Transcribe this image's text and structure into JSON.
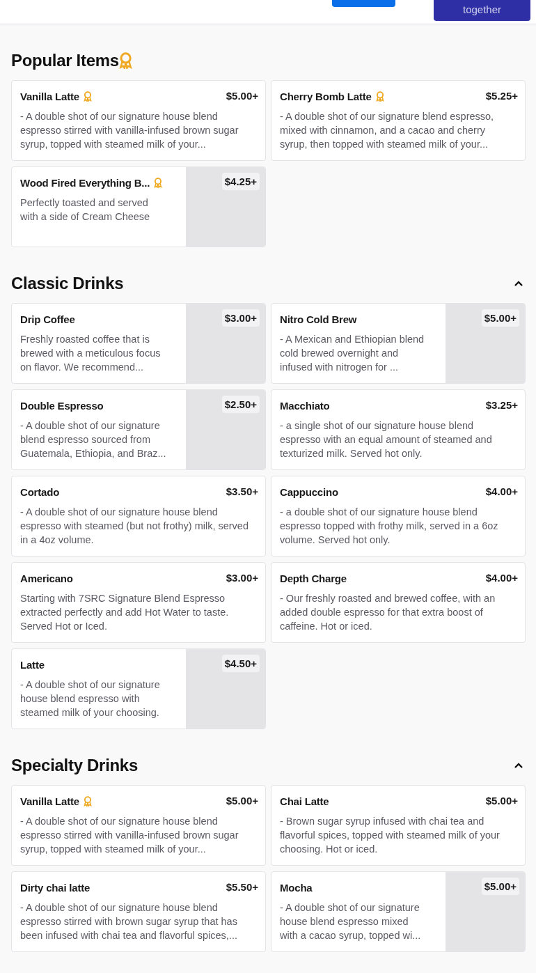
{
  "header": {
    "buttons": [
      {
        "kind": "primary"
      },
      {
        "kind": "secondary",
        "label": "together"
      }
    ]
  },
  "sections": [
    {
      "title": "Popular Items",
      "award": true,
      "items": [
        {
          "name": "Vanilla Latte",
          "award": true,
          "price": "$5.00+",
          "image": false,
          "description": "- A double shot of our signature house blend espresso stirred with vanilla-infused brown sugar syrup, topped with steamed milk of your..."
        },
        {
          "name": "Cherry Bomb Latte",
          "award": true,
          "price": "$5.25+",
          "image": false,
          "description": "- A double shot of our signature blend espresso, mixed with cinnamon, and a cacao and cherry syrup, then topped with steamed milk of your..."
        },
        {
          "name": "Wood Fired Everything B...",
          "award": true,
          "price": "$4.25+",
          "image": true,
          "description": "Perfectly toasted and served with a side of Cream Cheese"
        }
      ]
    },
    {
      "title": "Classic Drinks",
      "award": false,
      "expanded": true,
      "items": [
        {
          "name": "Drip Coffee",
          "award": false,
          "price": "$3.00+",
          "image": true,
          "description": "Freshly roasted coffee that is brewed with a meticulous focus on flavor. We recommend..."
        },
        {
          "name": "Nitro Cold Brew",
          "award": false,
          "price": "$5.00+",
          "image": true,
          "description": "- A Mexican and Ethiopian blend cold brewed overnight and infused with nitrogen for ..."
        },
        {
          "name": "Double Espresso",
          "award": false,
          "price": "$2.50+",
          "image": true,
          "description": "- A double shot of our signature blend espresso sourced from Guatemala, Ethiopia, and Braz..."
        },
        {
          "name": "Macchiato",
          "award": false,
          "price": "$3.25+",
          "image": false,
          "description": "- a single shot of our signature house blend espresso with an equal amount of steamed and texturized milk. Served hot only."
        },
        {
          "name": "Cortado",
          "award": false,
          "price": "$3.50+",
          "image": false,
          "description": "- A double shot of our signature house blend espresso with steamed (but not frothy) milk, served in a 4oz volume."
        },
        {
          "name": "Cappuccino",
          "award": false,
          "price": "$4.00+",
          "image": false,
          "description": "- a double shot of our signature house blend espresso topped with frothy milk, served in a 6oz volume. Served hot only."
        },
        {
          "name": "Americano",
          "award": false,
          "price": "$3.00+",
          "image": false,
          "description": "Starting with 7SRC Signature Blend Espresso extracted perfectly and add Hot Water to taste. Served Hot or Iced."
        },
        {
          "name": "Depth Charge",
          "award": false,
          "price": "$4.00+",
          "image": false,
          "description": "- Our freshly roasted and brewed coffee, with an added double espresso for that extra boost of caffeine. Hot or iced."
        },
        {
          "name": "Latte",
          "award": false,
          "price": "$4.50+",
          "image": true,
          "description": "- A double shot of our signature house blend espresso with steamed milk of your choosing."
        }
      ]
    },
    {
      "title": "Specialty Drinks",
      "award": false,
      "expanded": true,
      "items": [
        {
          "name": "Vanilla Latte",
          "award": true,
          "price": "$5.00+",
          "image": false,
          "description": "- A double shot of our signature house blend espresso stirred with vanilla-infused brown sugar syrup, topped with steamed milk of your..."
        },
        {
          "name": "Chai Latte",
          "award": false,
          "price": "$5.00+",
          "image": false,
          "description": "- Brown sugar syrup infused with chai tea and flavorful spices, topped with steamed milk of your choosing. Hot or iced."
        },
        {
          "name": "Dirty chai latte",
          "award": false,
          "price": "$5.50+",
          "image": false,
          "description": "- A double shot of our signature house blend espresso stirred with brown sugar syrup that has been infused with chai tea and flavorful spices,..."
        },
        {
          "name": "Mocha",
          "award": false,
          "price": "$5.00+",
          "image": true,
          "description": "- A double shot of our signature house blend espresso mixed with a cacao syrup, topped wi..."
        }
      ]
    }
  ]
}
